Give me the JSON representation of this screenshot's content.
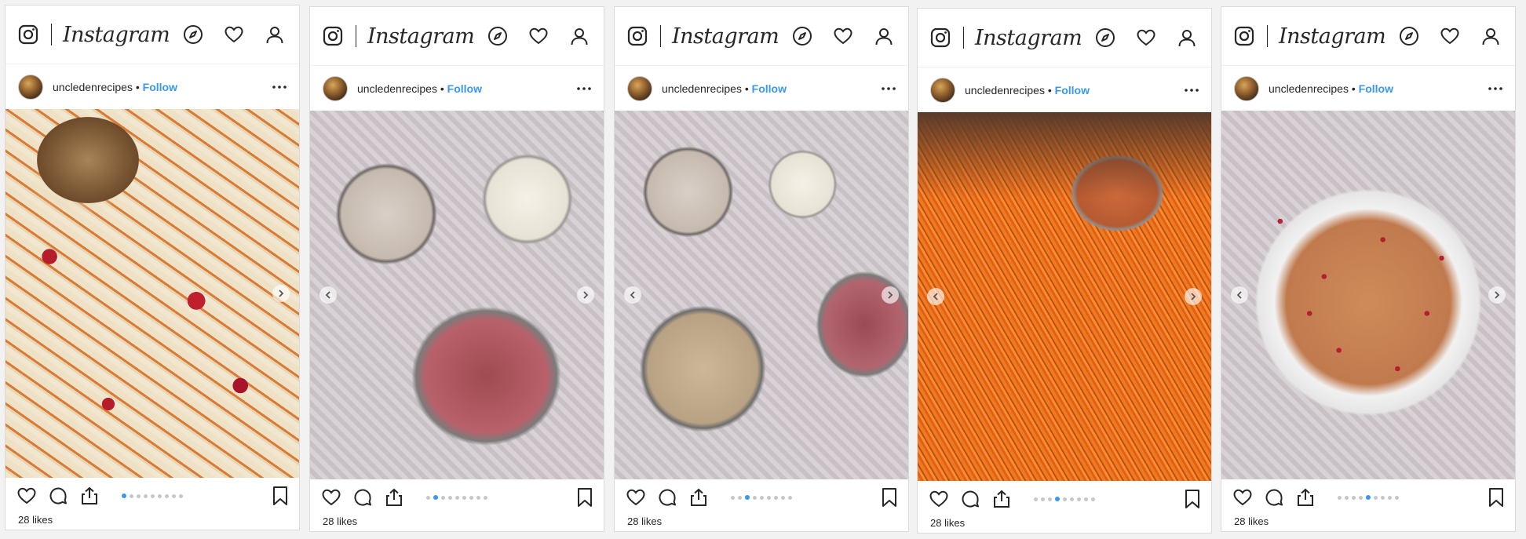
{
  "brand": {
    "wordmark": "Instagram"
  },
  "colors": {
    "follow": "#3897f0",
    "text": "#262626",
    "active_dot": "#3897f0"
  },
  "icons": {
    "logo": "instagram-camera-icon",
    "explore": "compass-icon",
    "activity": "heart-icon",
    "profile": "person-icon",
    "more": "ellipsis-icon",
    "like": "heart-outline-icon",
    "comment": "comment-bubble-icon",
    "share": "share-upload-icon",
    "save": "bookmark-icon",
    "prev": "chevron-left-icon",
    "next": "chevron-right-icon"
  },
  "posts": [
    {
      "username": "uncledenrecipes",
      "separator": "•",
      "follow_label": "Follow",
      "likes": "28 likes",
      "slide_index": 1,
      "slide_total": 9,
      "show_prev": false,
      "show_next": true
    },
    {
      "username": "uncledenrecipes",
      "separator": "•",
      "follow_label": "Follow",
      "likes": "28 likes",
      "slide_index": 2,
      "slide_total": 9,
      "show_prev": true,
      "show_next": true
    },
    {
      "username": "uncledenrecipes",
      "separator": "•",
      "follow_label": "Follow",
      "likes": "28 likes",
      "slide_index": 3,
      "slide_total": 9,
      "show_prev": true,
      "show_next": true
    },
    {
      "username": "uncledenrecipes",
      "separator": "•",
      "follow_label": "Follow",
      "likes": "28 likes",
      "slide_index": 4,
      "slide_total": 9,
      "show_prev": true,
      "show_next": true
    },
    {
      "username": "uncledenrecipes",
      "separator": "•",
      "follow_label": "Follow",
      "likes": "28 likes",
      "slide_index": 5,
      "slide_total": 9,
      "show_prev": true,
      "show_next": true
    }
  ]
}
